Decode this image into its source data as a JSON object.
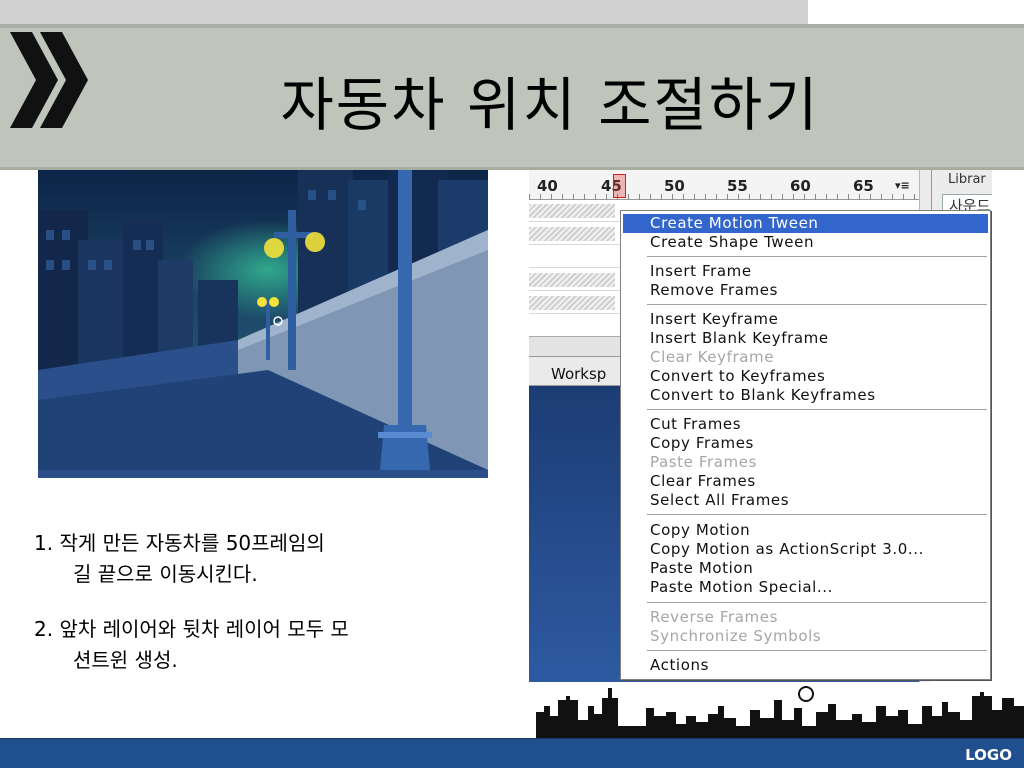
{
  "slide": {
    "title": "자동차 위치 조절하기",
    "logo": "LOGO"
  },
  "notes": [
    {
      "line1": "1.   작게 만든 자동차를 50프레임의",
      "line2": "길 끝으로 이동시킨다."
    },
    {
      "line1": "2. 앞차 레이어와 뒷차 레이어 모두 모",
      "line2": "션트윈 생성."
    }
  ],
  "flash": {
    "ruler_labels": [
      "40",
      "45",
      "50",
      "55",
      "60",
      "65"
    ],
    "workspace_label": "Worksp",
    "library_title": "Librar",
    "library_item": "사운드"
  },
  "context_menu": {
    "items": [
      {
        "label": "Create Motion Tween",
        "state": "selected"
      },
      {
        "label": "Create Shape Tween",
        "state": "enabled"
      },
      {
        "label": "Insert Frame",
        "state": "enabled"
      },
      {
        "label": "Remove Frames",
        "state": "enabled"
      },
      {
        "label": "Insert Keyframe",
        "state": "enabled"
      },
      {
        "label": "Insert Blank Keyframe",
        "state": "enabled"
      },
      {
        "label": "Clear Keyframe",
        "state": "disabled"
      },
      {
        "label": "Convert to Keyframes",
        "state": "enabled"
      },
      {
        "label": "Convert to Blank Keyframes",
        "state": "enabled"
      },
      {
        "label": "Cut Frames",
        "state": "enabled"
      },
      {
        "label": "Copy Frames",
        "state": "enabled"
      },
      {
        "label": "Paste Frames",
        "state": "disabled"
      },
      {
        "label": "Clear Frames",
        "state": "enabled"
      },
      {
        "label": "Select All Frames",
        "state": "enabled"
      },
      {
        "label": "Copy Motion",
        "state": "enabled"
      },
      {
        "label": "Copy Motion as ActionScript 3.0...",
        "state": "enabled"
      },
      {
        "label": "Paste Motion",
        "state": "enabled"
      },
      {
        "label": "Paste Motion Special...",
        "state": "enabled"
      },
      {
        "label": "Reverse Frames",
        "state": "disabled"
      },
      {
        "label": "Synchronize Symbols",
        "state": "disabled"
      },
      {
        "label": "Actions",
        "state": "enabled"
      }
    ]
  },
  "colors": {
    "title_bar": "#bfc5bb",
    "menu_highlight": "#3366cc",
    "footer": "#1f4f8f"
  }
}
